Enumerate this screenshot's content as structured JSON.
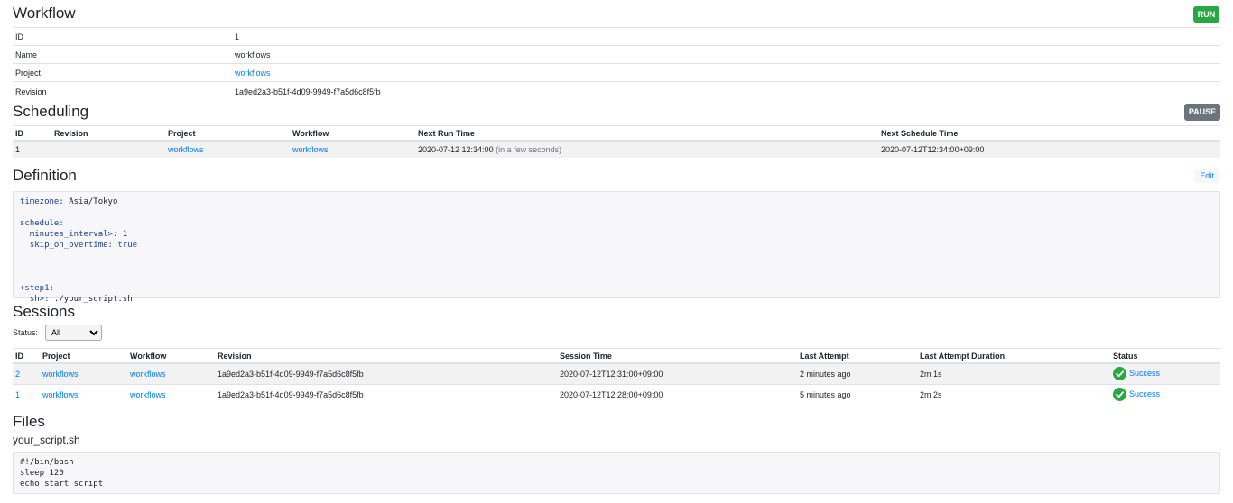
{
  "workflow": {
    "title": "Workflow",
    "run_label": "RUN",
    "rows": [
      {
        "key": "ID",
        "value": "1"
      },
      {
        "key": "Name",
        "value": "workflows"
      },
      {
        "key": "Project",
        "value": "workflows"
      },
      {
        "key": "Revision",
        "value": "1a9ed2a3-b51f-4d09-9949-f7a5d6c8f5fb"
      }
    ]
  },
  "scheduling": {
    "title": "Scheduling",
    "pause_label": "PAUSE",
    "headers": [
      "ID",
      "Revision",
      "Project",
      "Workflow",
      "Next Run Time",
      "Next Schedule Time"
    ],
    "row": {
      "id": "1",
      "revision": "",
      "project": "workflows",
      "workflow": "workflows",
      "next_run_time": "2020-07-12 12:34:00",
      "next_run_relative": "(in a few seconds)",
      "next_schedule_time": "2020-07-12T12:34:00+09:00"
    }
  },
  "definition": {
    "title": "Definition",
    "edit_label": "Edit",
    "k_timezone": "timezone:",
    "v_timezone": " Asia/Tokyo",
    "k_schedule": "schedule:",
    "k_minutes": "  minutes_interval>:",
    "v_minutes": " 1",
    "k_skip": "  skip_on_overtime:",
    "v_skip": " true",
    "k_step": "+step1:",
    "k_sh": "  sh>:",
    "v_sh": " ./your_script.sh"
  },
  "sessions": {
    "title": "Sessions",
    "status_label": "Status:",
    "status_selected": "All",
    "headers": [
      "ID",
      "Project",
      "Workflow",
      "Revision",
      "Session Time",
      "Last Attempt",
      "Last Attempt Duration",
      "Status"
    ],
    "rows": [
      {
        "id": "2",
        "project": "workflows",
        "workflow": "workflows",
        "revision": "1a9ed2a3-b51f-4d09-9949-f7a5d6c8f5fb",
        "session_time": "2020-07-12T12:31:00+09:00",
        "last_attempt": "2 minutes ago",
        "duration": "2m 1s",
        "status": "Success"
      },
      {
        "id": "1",
        "project": "workflows",
        "workflow": "workflows",
        "revision": "1a9ed2a3-b51f-4d09-9949-f7a5d6c8f5fb",
        "session_time": "2020-07-12T12:28:00+09:00",
        "last_attempt": "5 minutes ago",
        "duration": "2m 2s",
        "status": "Success"
      }
    ]
  },
  "files": {
    "title": "Files",
    "filename": "your_script.sh",
    "content": "#!/bin/bash\nsleep 120\necho start script"
  },
  "colors": {
    "success": "#28a745",
    "secondary": "#6c757d",
    "link": "#007bff"
  }
}
